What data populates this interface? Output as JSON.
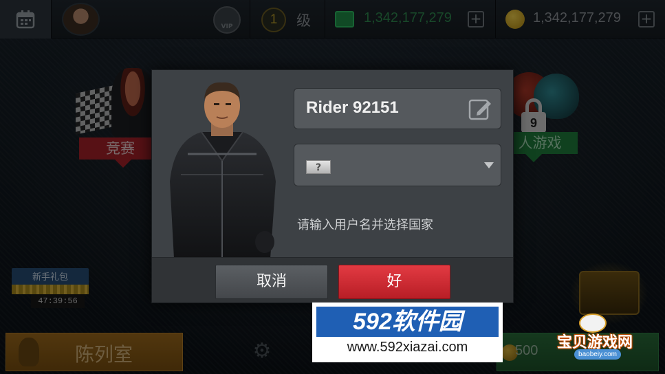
{
  "topbar": {
    "vip_label": "VIP",
    "level_value": "1",
    "level_label": "级",
    "cash_value": "1,342,177,279",
    "gold_value": "1,342,177,279",
    "plus_symbol": "+"
  },
  "menu": {
    "race_label": "竞赛",
    "multiplayer_label": "人游戏",
    "multiplayer_lock_level": "9"
  },
  "gift_pack": {
    "title": "新手礼包",
    "timer": "47:39:56"
  },
  "bottombar": {
    "garage_label": "陈列室",
    "buy_value": "500"
  },
  "dialog": {
    "name_value": "Rider 92151",
    "country_flag_placeholder": "?",
    "hint": "请输入用户名并选择国家",
    "cancel_label": "取消",
    "ok_label": "好"
  },
  "watermarks": {
    "site1_logo": "592软件园",
    "site1_url": "www.592xiazai.com",
    "site2_title": "宝贝游戏网",
    "site2_url": "baobeiy.com"
  },
  "colors": {
    "ok_button": "#d8323a",
    "race_tag": "#a8212a",
    "multiplayer_tag": "#1f7e3d",
    "cash": "#2e8a4f"
  }
}
